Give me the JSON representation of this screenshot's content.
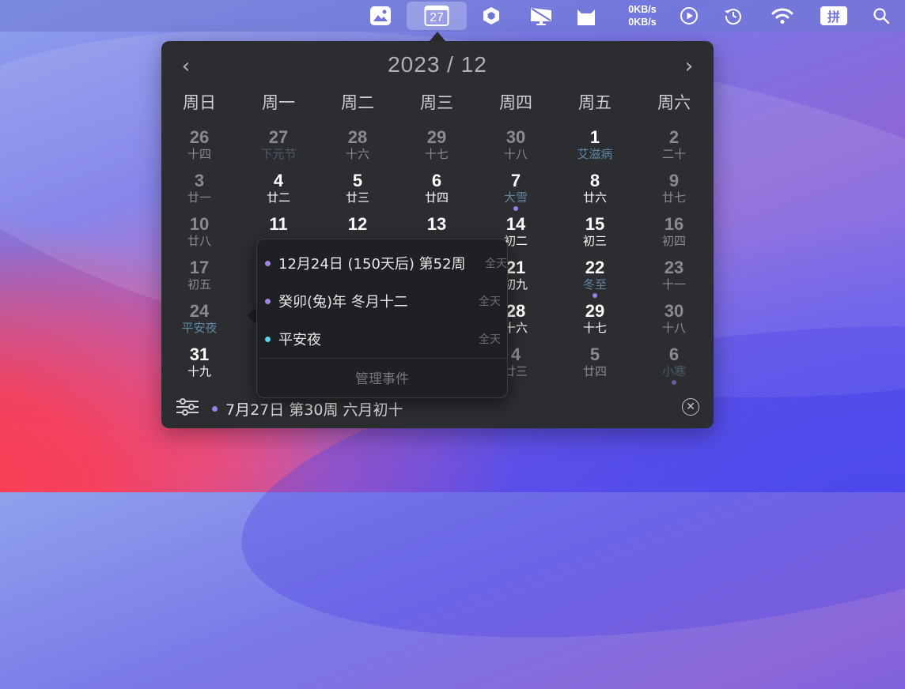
{
  "menubar": {
    "net_up": "0KB/s",
    "net_down": "0KB/s",
    "calendar_day": "27",
    "input_method": "拼"
  },
  "calendar": {
    "title": "2023 / 12",
    "prev": "‹",
    "next": "›",
    "weekdays": [
      "周日",
      "周一",
      "周二",
      "周三",
      "周四",
      "周五",
      "周六"
    ],
    "weeks": [
      [
        {
          "d": "26",
          "l": "十四"
        },
        {
          "d": "27",
          "l": "下元节"
        },
        {
          "d": "28",
          "l": "十六"
        },
        {
          "d": "29",
          "l": "十七"
        },
        {
          "d": "30",
          "l": "十八"
        },
        {
          "d": "1",
          "l": "艾滋病"
        },
        {
          "d": "2",
          "l": "二十"
        }
      ],
      [
        {
          "d": "3",
          "l": "廿一"
        },
        {
          "d": "4",
          "l": "廿二"
        },
        {
          "d": "5",
          "l": "廿三"
        },
        {
          "d": "6",
          "l": "廿四"
        },
        {
          "d": "7",
          "l": "大雪"
        },
        {
          "d": "8",
          "l": "廿六"
        },
        {
          "d": "9",
          "l": "廿七"
        }
      ],
      [
        {
          "d": "10",
          "l": "廿八"
        },
        {
          "d": "11",
          "l": ""
        },
        {
          "d": "12",
          "l": ""
        },
        {
          "d": "13",
          "l": ""
        },
        {
          "d": "14",
          "l": "初二"
        },
        {
          "d": "15",
          "l": "初三"
        },
        {
          "d": "16",
          "l": "初四"
        }
      ],
      [
        {
          "d": "17",
          "l": "初五"
        },
        {
          "d": "",
          "l": ""
        },
        {
          "d": "",
          "l": ""
        },
        {
          "d": "",
          "l": ""
        },
        {
          "d": "21",
          "l": "初九"
        },
        {
          "d": "22",
          "l": "冬至"
        },
        {
          "d": "23",
          "l": "十一"
        }
      ],
      [
        {
          "d": "24",
          "l": "平安夜"
        },
        {
          "d": "",
          "l": ""
        },
        {
          "d": "",
          "l": ""
        },
        {
          "d": "",
          "l": ""
        },
        {
          "d": "28",
          "l": "十六"
        },
        {
          "d": "29",
          "l": "十七"
        },
        {
          "d": "30",
          "l": "十八"
        }
      ],
      [
        {
          "d": "31",
          "l": "十九"
        },
        {
          "d": "",
          "l": ""
        },
        {
          "d": "",
          "l": ""
        },
        {
          "d": "",
          "l": ""
        },
        {
          "d": "4",
          "l": "廿三"
        },
        {
          "d": "5",
          "l": "廿四"
        },
        {
          "d": "6",
          "l": "小寒"
        }
      ]
    ],
    "footer_text": "7月27日 第30周 六月初十"
  },
  "event_popup": {
    "events": [
      {
        "text": "12月24日 (150天后) 第52周",
        "allday": "全天",
        "color": "#a084e8"
      },
      {
        "text": "癸卯(兔)年 冬月十二",
        "allday": "全天",
        "color": "#a084e8"
      },
      {
        "text": "平安夜",
        "allday": "全天",
        "color": "#5ad1e6"
      }
    ],
    "manage": "管理事件"
  }
}
